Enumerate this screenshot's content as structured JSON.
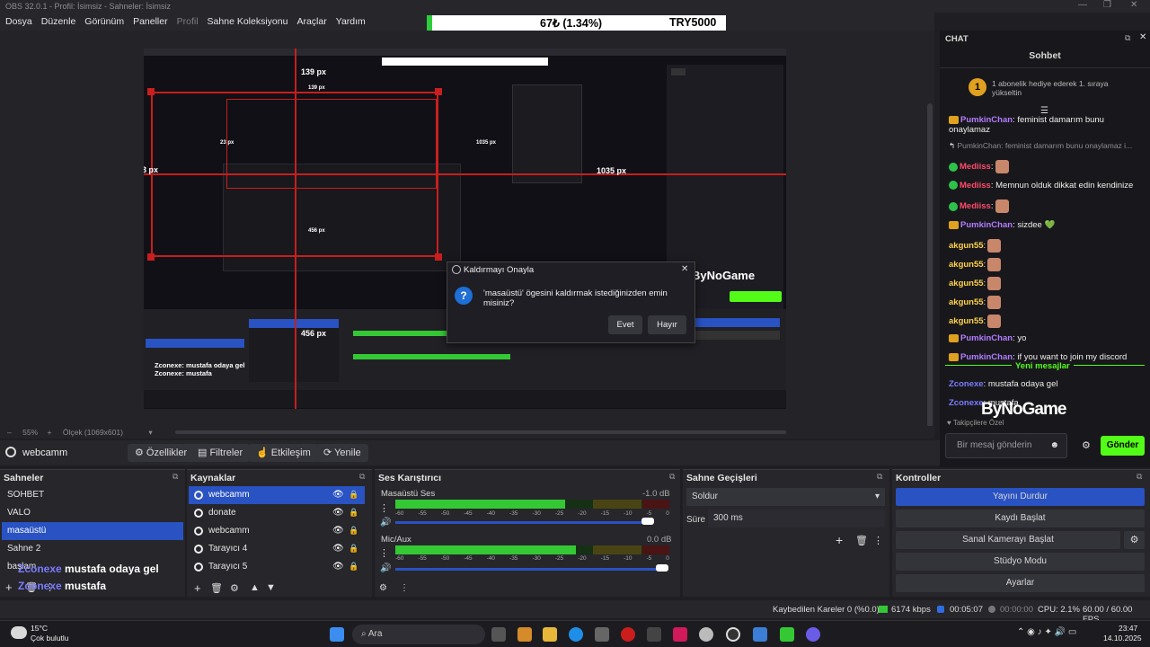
{
  "window": {
    "title": "OBS 32.0.1 - Profil: İsimsiz - Sahneler: İsimsiz"
  },
  "menu": [
    "Dosya",
    "Düzenle",
    "Görünüm",
    "Paneller",
    "Profil",
    "Sahne Koleksiyonu",
    "Araçlar",
    "Yardım"
  ],
  "ticker": {
    "left": "67₺ (1.34%)",
    "right": "TRY5000"
  },
  "preview": {
    "measure_top": "139 px",
    "measure_left": "23 px",
    "measure_right": "1035 px",
    "measure_bottom": "456 px",
    "nested_measure_top": "139 px",
    "nested_measure_left": "23 px",
    "nested_measure_right": "1035 px",
    "nested_measure_bottom": "456 px",
    "nested_brand": "ByNoGame",
    "nested_overlay_1": "Zconexe: mustafa odaya gel",
    "nested_overlay_2": "Zconexe: mustafa",
    "brand": "ByNoGame"
  },
  "dialog": {
    "title": "Kaldırmayı Onayla",
    "message": "'masaüstü' ögesini kaldırmak istediğinizden emin misiniz?",
    "yes": "Evet",
    "no": "Hayır"
  },
  "preview_status": {
    "zoom_label": "55%",
    "scale_label": "Ölçek (1069x601)"
  },
  "sourcebar": {
    "source_name": "webcamm",
    "properties": "Özellikler",
    "filters": "Filtreler",
    "interact": "Etkileşim",
    "refresh": "Yenile"
  },
  "scenes": {
    "title": "Sahneler",
    "items": [
      "SOHBET",
      "VALO",
      "masaüstü",
      "Sahne 2",
      "başlam"
    ]
  },
  "sources": {
    "title": "Kaynaklar",
    "items": [
      "webcamm",
      "donate",
      "webcamm",
      "Tarayıcı 4",
      "Tarayıcı 5"
    ]
  },
  "mixer": {
    "title": "Ses Karıştırıcı",
    "channels": [
      {
        "name": "Masaüstü Ses",
        "db": "-1.0 dB",
        "level": 0.62
      },
      {
        "name": "Mic/Aux",
        "db": "0.0 dB",
        "level": 0.66
      }
    ],
    "ticks": [
      "-60",
      "-55",
      "-50",
      "-45",
      "-40",
      "-35",
      "-30",
      "-25",
      "-20",
      "-15",
      "-10",
      "-5",
      "0"
    ]
  },
  "transitions": {
    "title": "Sahne Geçişleri",
    "type": "Soldur",
    "duration_label": "Süre",
    "duration": "300 ms"
  },
  "controls": {
    "title": "Kontroller",
    "stop_stream": "Yayını Durdur",
    "start_record": "Kaydı Başlat",
    "virtual_cam": "Sanal Kamerayı Başlat",
    "studio_mode": "Stüdyo Modu",
    "settings": "Ayarlar"
  },
  "overlay": {
    "line1_nick": "Zconexe",
    "line1_text": " mustafa odaya gel",
    "line2_nick": "Zconexe",
    "line2_text": " mustafa"
  },
  "chat": {
    "header": "CHAT",
    "title": "Sohbet",
    "pinned": "1 abonelik hediye ederek 1. sıraya yükseltin",
    "messages": [
      {
        "nick": "PumkinChan",
        "text": ": feminist damarım bunu onaylamaz",
        "badge": "crown",
        "color": "#b27cff"
      },
      {
        "nick": "",
        "text": "PumkinChan: feminist damarım bunu onaylamaz i...",
        "badge": "reply",
        "color": "#8d8d92"
      },
      {
        "nick": "Mediiss",
        "text": ":",
        "badge": "check",
        "color": "#ff4a6a",
        "emote": true
      },
      {
        "nick": "Mediiss",
        "text": ": Memnun olduk dikkat edin kendinize",
        "badge": "check",
        "color": "#ff4a6a"
      },
      {
        "nick": "Mediiss",
        "text": ":",
        "badge": "check",
        "color": "#ff4a6a",
        "emote": true
      },
      {
        "nick": "PumkinChan",
        "text": ": sizdee 💚",
        "badge": "crown",
        "color": "#b27cff"
      },
      {
        "nick": "akgun55",
        "text": ":",
        "badge": "",
        "color": "#ffd24a",
        "emote": true
      },
      {
        "nick": "akgun55",
        "text": ":",
        "badge": "",
        "color": "#ffd24a",
        "emote": true
      },
      {
        "nick": "akgun55",
        "text": ":",
        "badge": "",
        "color": "#ffd24a",
        "emote": true
      },
      {
        "nick": "akgun55",
        "text": ":",
        "badge": "",
        "color": "#ffd24a",
        "emote": true
      },
      {
        "nick": "akgun55",
        "text": ":",
        "badge": "",
        "color": "#ffd24a",
        "emote": true
      },
      {
        "nick": "PumkinChan",
        "text": ": yo",
        "badge": "crown",
        "color": "#b27cff"
      },
      {
        "nick": "PumkinChan",
        "text": ": if you want to join my discord",
        "badge": "crown",
        "color": "#b27cff"
      }
    ],
    "new_messages": "Yeni mesajlar",
    "after": [
      {
        "nick": "Zconexe",
        "text": ": mustafa odaya gel"
      },
      {
        "nick": "Zconexe",
        "text": ": mustafa"
      }
    ],
    "followers": "Takipçilere Özel",
    "input_placeholder": "Bir mesaj gönderin",
    "send": "Gönder"
  },
  "status": {
    "dropped": "Kaybedilen Kareler 0 (%0.0)",
    "bitrate": "6174 kbps",
    "stream_time": "00:05:07",
    "record_time": "00:00:00",
    "cpu": "CPU: 2.1%",
    "fps": "60.00 / 60.00 FPS"
  },
  "taskbar": {
    "weather_temp": "15°C",
    "weather_desc": "Çok bulutlu",
    "search": "Ara",
    "time": "23:47",
    "date": "14.10.2025"
  },
  "colors": {
    "accent": "#2952c2",
    "meter_green": "#35c835",
    "meter_yellow": "#c8c820",
    "meter_red": "#c82020",
    "send_green": "#53fc18",
    "danger": "#c81e1e"
  }
}
